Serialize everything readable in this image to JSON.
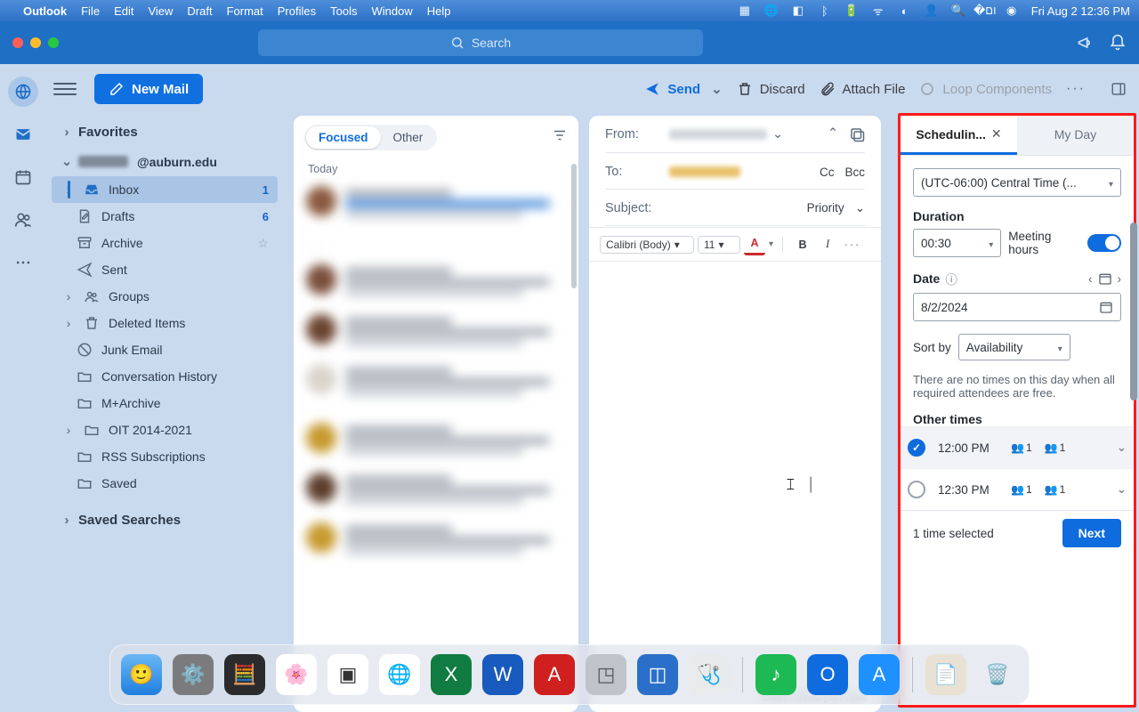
{
  "menubar": {
    "app": "Outlook",
    "items": [
      "File",
      "Edit",
      "View",
      "Draft",
      "Format",
      "Profiles",
      "Tools",
      "Window",
      "Help"
    ],
    "clock": "Fri Aug 2  12:36 PM"
  },
  "titlebar": {
    "search": "Search"
  },
  "toolbar": {
    "new_mail": "New Mail",
    "send": "Send",
    "discard": "Discard",
    "attach": "Attach File",
    "loop": "Loop Components"
  },
  "sidebar": {
    "favorites": "Favorites",
    "account_suffix": "@auburn.edu",
    "items": [
      {
        "label": "Inbox",
        "count": "1",
        "icon": "inbox",
        "selected": true,
        "expand": true
      },
      {
        "label": "Drafts",
        "count": "6",
        "icon": "draft"
      },
      {
        "label": "Archive",
        "icon": "archive",
        "star": true
      },
      {
        "label": "Sent",
        "icon": "sent"
      },
      {
        "label": "Groups",
        "icon": "groups",
        "expand": true
      },
      {
        "label": "Deleted Items",
        "icon": "trash",
        "expand": true
      },
      {
        "label": "Junk Email",
        "icon": "junk"
      },
      {
        "label": "Conversation History",
        "icon": "folder"
      },
      {
        "label": "M+Archive",
        "icon": "folder"
      },
      {
        "label": "OIT 2014-2021",
        "icon": "folder",
        "expand": true
      },
      {
        "label": "RSS Subscriptions",
        "icon": "folder"
      },
      {
        "label": "Saved",
        "icon": "folder"
      }
    ],
    "saved_searches": "Saved Searches"
  },
  "msglist": {
    "tabs": {
      "focused": "Focused",
      "other": "Other"
    },
    "group_today": "Today"
  },
  "compose": {
    "from": "From:",
    "to": "To:",
    "cc": "Cc",
    "bcc": "Bcc",
    "subject": "Subject:",
    "priority": "Priority",
    "font": "Calibri (Body)",
    "size": "11",
    "status": "Draft saved just now"
  },
  "panel": {
    "tab_sched": "Schedulin...",
    "tab_myday": "My Day",
    "timezone": "(UTC-06:00) Central Time (...",
    "duration_label": "Duration",
    "duration_value": "00:30",
    "meeting_hours": "Meeting hours",
    "date_label": "Date",
    "date_value": "8/2/2024",
    "sortby_label": "Sort by",
    "sortby_value": "Availability",
    "no_times": "There are no times on this day when all required attendees are free.",
    "other_times": "Other times",
    "slots": [
      {
        "time": "12:00 PM",
        "avail": "1",
        "busy": "1",
        "selected": true
      },
      {
        "time": "12:30 PM",
        "avail": "1",
        "busy": "1",
        "selected": false
      }
    ],
    "footer_status": "1 time selected",
    "next": "Next"
  }
}
